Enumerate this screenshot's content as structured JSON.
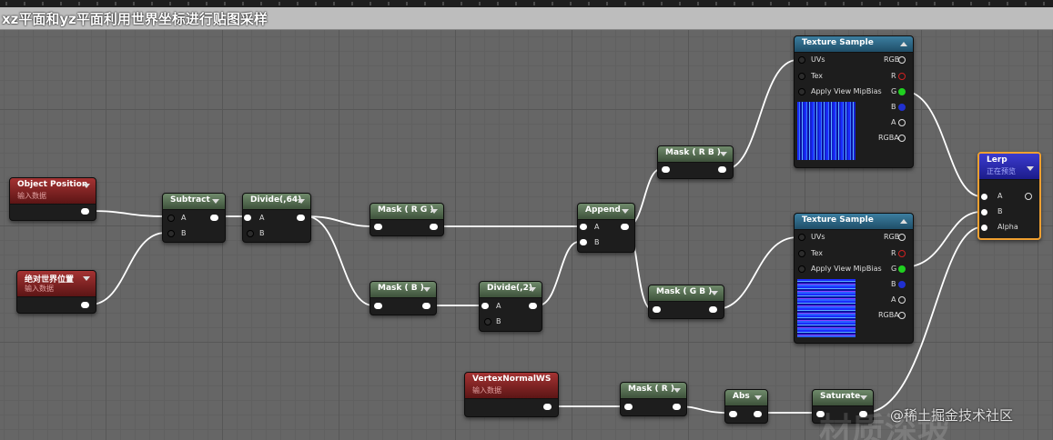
{
  "title": "xz平面和yz平面利用世界坐标进行贴图采样",
  "watermark": "@稀土掘金技术社区",
  "watermark_bg": "材质深坡",
  "colors": {
    "wire": "#ffffff",
    "accent_lerp": "#f0a030",
    "pin_red": "#d02020",
    "pin_green": "#20d020",
    "pin_blue": "#2030d0"
  },
  "nodes": {
    "object_position": {
      "title": "Object Position",
      "sub": "输入数据"
    },
    "world_position": {
      "title": "绝对世界位置",
      "sub": "输入数据"
    },
    "subtract": {
      "title": "Subtract",
      "a": "A",
      "b": "B"
    },
    "divide64": {
      "title": "Divide(,64)",
      "a": "A",
      "b": "B"
    },
    "mask_rg": {
      "title": "Mask ( R G )"
    },
    "mask_b": {
      "title": "Mask ( B )"
    },
    "divide2": {
      "title": "Divide(,2)",
      "a": "A",
      "b": "B"
    },
    "append": {
      "title": "Append",
      "a": "A",
      "b": "B"
    },
    "mask_rb": {
      "title": "Mask ( R B )"
    },
    "mask_gb": {
      "title": "Mask ( G B )"
    },
    "tex1": {
      "title": "Texture Sample",
      "uvs": "UVs",
      "tex": "Tex",
      "mip": "Apply View MipBias",
      "rgb": "RGB",
      "r": "R",
      "g": "G",
      "b": "B",
      "a": "A",
      "rgba": "RGBA"
    },
    "tex2": {
      "title": "Texture Sample",
      "uvs": "UVs",
      "tex": "Tex",
      "mip": "Apply View MipBias",
      "rgb": "RGB",
      "r": "R",
      "g": "G",
      "b": "B",
      "a": "A",
      "rgba": "RGBA"
    },
    "lerp": {
      "title": "Lerp",
      "sub": "正在预览",
      "a": "A",
      "b": "B",
      "alpha": "Alpha"
    },
    "vertex_normal": {
      "title": "VertexNormalWS",
      "sub": "输入数据"
    },
    "mask_r": {
      "title": "Mask ( R )"
    },
    "abs": {
      "title": "Abs"
    },
    "saturate": {
      "title": "Saturate"
    }
  }
}
